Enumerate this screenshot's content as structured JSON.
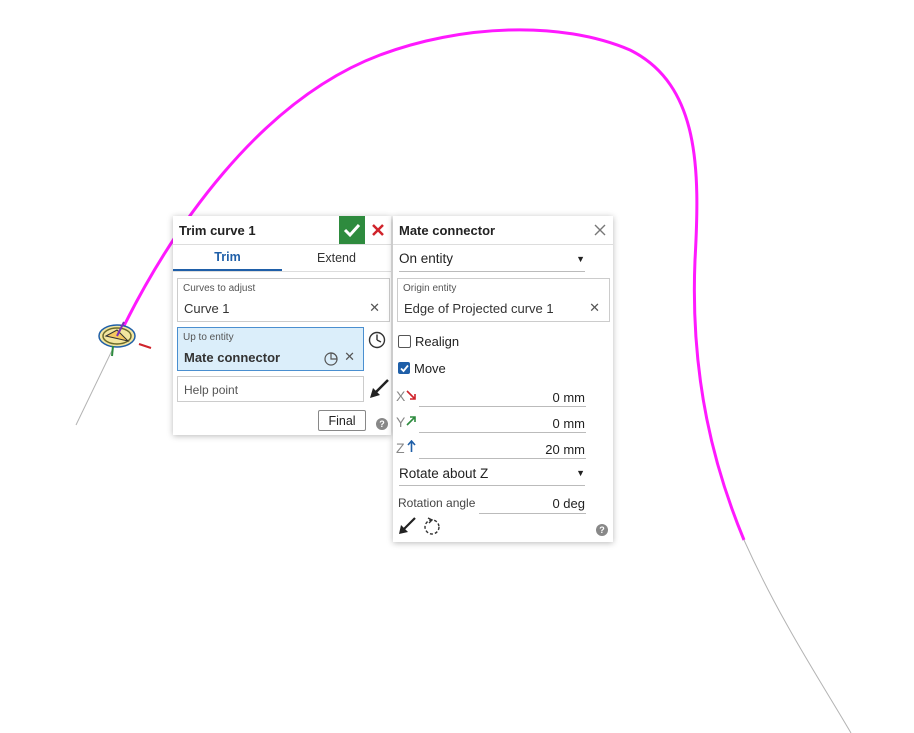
{
  "colors": {
    "curve": "#ff19ff",
    "curve_extension": "#b3b3b3",
    "confirm": "#2e8b3e",
    "cancel": "#d0232b",
    "active_tab": "#1f5fa8",
    "selected_field": "#dbeefa"
  },
  "trim_panel": {
    "title": "Trim curve 1",
    "tabs": [
      "Trim",
      "Extend"
    ],
    "active_tab": "Trim",
    "curves_label": "Curves to adjust",
    "curves_value": "Curve 1",
    "up_to_label": "Up to entity",
    "up_to_value": "Mate connector",
    "help_point_placeholder": "Help point",
    "final_button": "Final"
  },
  "mate_panel": {
    "title": "Mate connector",
    "on_entity": "On entity",
    "origin_label": "Origin entity",
    "origin_value": "Edge of Projected curve 1",
    "realign_label": "Realign",
    "realign_checked": false,
    "move_label": "Move",
    "move_checked": true,
    "x_label": "X",
    "x_value": "0 mm",
    "y_label": "Y",
    "y_value": "0 mm",
    "z_label": "Z",
    "z_value": "20 mm",
    "rotate_option": "Rotate about Z",
    "rotation_label": "Rotation angle",
    "rotation_value": "0 deg"
  }
}
